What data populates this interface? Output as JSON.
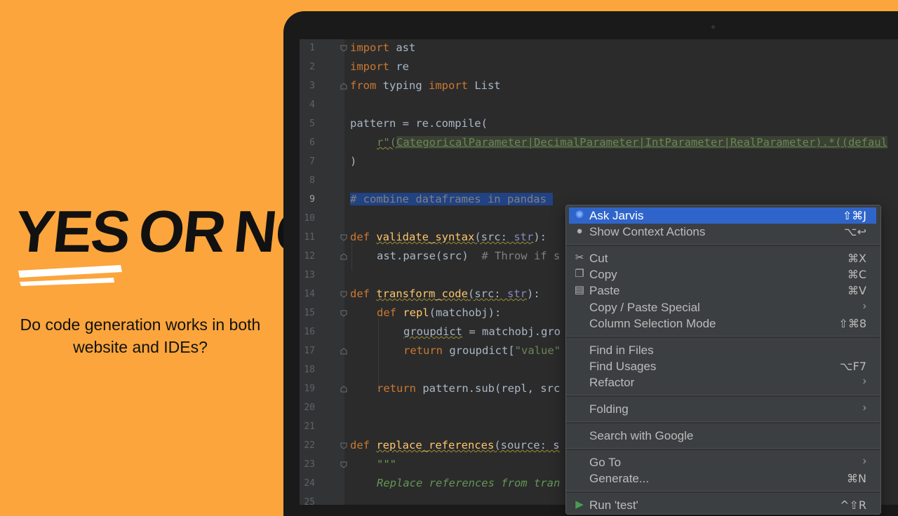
{
  "promo": {
    "headline": [
      "YES",
      "OR",
      "NO"
    ],
    "subtitle_line1": "Do code generation works in both",
    "subtitle_line2": "website and IDEs?"
  },
  "editor": {
    "line_numbers": [
      "1",
      "2",
      "3",
      "4",
      "5",
      "6",
      "7",
      "8",
      "9",
      "10",
      "11",
      "12",
      "13",
      "14",
      "15",
      "16",
      "17",
      "18",
      "19",
      "20",
      "21",
      "22",
      "23",
      "24",
      "25"
    ],
    "current_line": "9"
  },
  "code": {
    "l1_kw": "import",
    "l1_mod": " ast",
    "l2_kw": "import",
    "l2_mod": " re",
    "l3_kw1": "from",
    "l3_mod": " typing ",
    "l3_kw2": "import",
    "l3_name": " List",
    "l5": "pattern = re.compile(",
    "l6_prefix": "r\"(",
    "l6_p1": "CategoricalParameter",
    "l6_bar": "|",
    "l6_p2": "DecimalParameter",
    "l6_p3": "IntParameter",
    "l6_p4": "RealParameter",
    "l6_tail": ").*((defaul",
    "l7": ")",
    "l9": "# combine dataframes in pandas",
    "l11_kw": "def ",
    "l11_fn": "validate_syntax",
    "l11_args": "(src: ",
    "l11_type": "str",
    "l11_end": "):",
    "l12_call": "ast.parse(src)",
    "l12_cm": "  # Throw if s",
    "l14_kw": "def ",
    "l14_fn": "transform_code",
    "l14_args": "(src: ",
    "l14_type": "str",
    "l14_end": "):",
    "l15_kw": "def ",
    "l15_fn": "repl",
    "l15_args": "(matchobj):",
    "l16_var": "groupdict",
    "l16_rest": " = matchobj.gro",
    "l17_kw": "return ",
    "l17_rest": "groupdict[",
    "l17_str": "\"value\"",
    "l19_kw": "return ",
    "l19_rest": "pattern.sub(repl, src",
    "l22_kw": "def ",
    "l22_fn": "replace_references",
    "l22_args": "(source: s",
    "l23": "\"\"\"",
    "l24": "Replace references from tran"
  },
  "menu": {
    "items": [
      {
        "label": "Ask Jarvis",
        "shortcut": "⇧⌘J",
        "icon": "jarvis-icon"
      },
      {
        "label": "Show Context Actions",
        "shortcut": "⌥↩",
        "icon": "lightbulb-icon"
      },
      {
        "label": "Cut",
        "shortcut": "⌘X",
        "icon": "scissors-icon"
      },
      {
        "label": "Copy",
        "shortcut": "⌘C",
        "icon": "copy-icon"
      },
      {
        "label": "Paste",
        "shortcut": "⌘V",
        "icon": "clipboard-icon"
      },
      {
        "label": "Copy / Paste Special",
        "shortcut": "",
        "submenu": true
      },
      {
        "label": "Column Selection Mode",
        "shortcut": "⇧⌘8"
      },
      {
        "label": "Find in Files",
        "shortcut": ""
      },
      {
        "label": "Find Usages",
        "shortcut": "⌥F7"
      },
      {
        "label": "Refactor",
        "shortcut": "",
        "submenu": true
      },
      {
        "label": "Folding",
        "shortcut": "",
        "submenu": true
      },
      {
        "label": "Search with Google",
        "shortcut": ""
      },
      {
        "label": "Go To",
        "shortcut": "",
        "submenu": true
      },
      {
        "label": "Generate...",
        "shortcut": "⌘N"
      },
      {
        "label": "Run 'test'",
        "shortcut": "^⇧R",
        "icon": "run-icon"
      }
    ],
    "arrow": "›"
  },
  "colors": {
    "background": "#FBA53C",
    "editor_bg": "#2B2B2B",
    "menu_bg": "#3C3F41",
    "menu_highlight": "#2F65CA",
    "selection": "#214283"
  }
}
